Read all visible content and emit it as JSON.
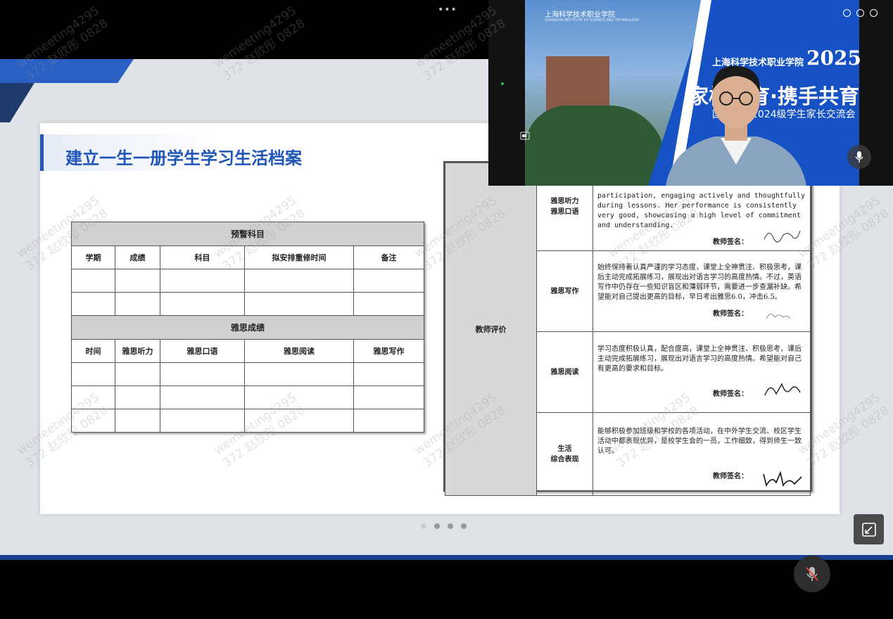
{
  "top_bar": {
    "more": "•••"
  },
  "slide": {
    "title": "建立一生一册学生学习生活档案",
    "left_table": {
      "section1": "预警科目",
      "headers1": [
        "学期",
        "成绩",
        "科目",
        "拟安排重修时间",
        "备注"
      ],
      "section2": "雅思成绩",
      "headers2": [
        "时间",
        "雅思听力",
        "雅思口语",
        "雅思阅读",
        "雅思写作"
      ]
    },
    "right_doc": {
      "row_label": "教师评价",
      "sign_label": "教师签名：",
      "entries": [
        {
          "subject": "雅思听力\n雅思口语",
          "text": "participation, engaging actively and thoughtfully during lessons. Her performance is consistently very good, showcasing a high level of commitment and understanding."
        },
        {
          "subject": "雅思写作",
          "text": "始终保持着认真严谨的学习态度，课堂上全神贯注、积极思考，课后主动完成拓展练习，展现出对语言学习的高度热情。不过，英语写作中仍存在一些知识盲区和薄弱环节，需要进一步查漏补缺。希望能对自己提出更高的目标，早日考出雅思6.0，冲击6.5。"
        },
        {
          "subject": "雅思阅读",
          "text": "学习态度积极认真，配合度高，课堂上全神贯注、积极思考，课后主动完成拓展练习，展现出对语言学习的高度热情。希望能对自己有更高的要求和目标。"
        },
        {
          "subject": "生活\n综合表现",
          "text": "能够积极参加班级和学校的各项活动，在中外学生交流、校区学生活动中都表现优异，是校学生会的一员，工作细致，得到师生一致认可。"
        }
      ]
    }
  },
  "video": {
    "school_cn": "上海科学技术职业学院",
    "school_en": "SHANGHAI INSTITUTE OF SCIENCE AND TECHNOLOGY",
    "institute": "上海科学技术职业学院",
    "year": "2025",
    "headline": "家校共育·携手共育",
    "subline": "国际学院2024级学生家长交流会"
  },
  "watermark": "wemeeting4295\n372 赵欣彤 0828",
  "colors": {
    "accent": "#1f56b8",
    "banner_blue": "#1652c3"
  }
}
